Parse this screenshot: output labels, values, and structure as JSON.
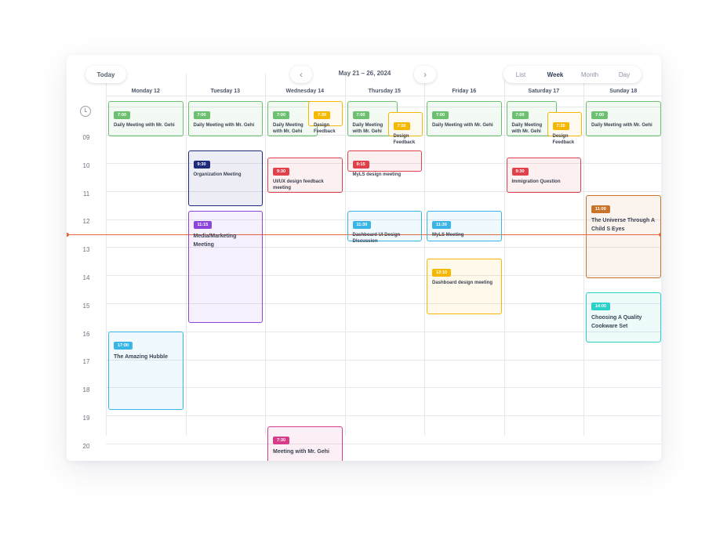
{
  "toolbar": {
    "today_label": "Today",
    "prev_glyph": "‹",
    "next_glyph": "›",
    "range_label": "May 21 – 26, 2024",
    "views": [
      "List",
      "Week",
      "Month",
      "Day"
    ],
    "active_view": "Week"
  },
  "days": [
    "Monday 12",
    "Tuesday 13",
    "Wednesday 14",
    "Thursday 15",
    "Friday 16",
    "Saturday 17",
    "Sunday 18"
  ],
  "hours": [
    "09",
    "10",
    "11",
    "12",
    "13",
    "14",
    "15",
    "16",
    "17",
    "18",
    "19",
    "20"
  ],
  "icons": {
    "allday": "clock-icon"
  },
  "colors": {
    "green": "#6cc070",
    "yellow": "#f5b800",
    "navy": "#1f2a7a",
    "red": "#e0414b",
    "purple": "#8c45d9",
    "cyan": "#3bb5e6",
    "orange": "#c9742a",
    "teal": "#2ad1c9",
    "pink": "#d63c8a",
    "now": "#e8643c"
  },
  "events": [
    {
      "day": 0,
      "start": 8,
      "end": 9.25,
      "time": "7:00",
      "title": "Daily Meeting with Mr. Gehi",
      "color": "green"
    },
    {
      "day": 1,
      "start": 8,
      "end": 9.25,
      "time": "7:00",
      "title": "Daily Meeting with Mr. Gehi",
      "color": "green"
    },
    {
      "day": 2,
      "start": 8,
      "end": 9.25,
      "time": "7:00",
      "title": "Daily Meeting with Mr. Gehi",
      "color": "green",
      "half": "left"
    },
    {
      "day": 2,
      "start": 8,
      "end": 8.9,
      "time": "7:30",
      "title": "Design Feedback",
      "color": "yellow",
      "half": "right"
    },
    {
      "day": 3,
      "start": 8,
      "end": 9.25,
      "time": "7:00",
      "title": "Daily Meeting with Mr. Gehi",
      "color": "green",
      "half": "left"
    },
    {
      "day": 3,
      "start": 8.4,
      "end": 9.25,
      "time": "7:30",
      "title": "Design Feedback",
      "color": "yellow",
      "half": "right"
    },
    {
      "day": 4,
      "start": 8,
      "end": 9.25,
      "time": "7:00",
      "title": "Daily Meeting with Mr. Gehi",
      "color": "green"
    },
    {
      "day": 5,
      "start": 8,
      "end": 9.25,
      "time": "7:00",
      "title": "Daily Meeting with Mr. Gehi",
      "color": "green",
      "half": "left"
    },
    {
      "day": 5,
      "start": 8.4,
      "end": 9.25,
      "time": "7:30",
      "title": "Design Feedback",
      "color": "yellow",
      "half": "right"
    },
    {
      "day": 6,
      "start": 8,
      "end": 9.25,
      "time": "7:00",
      "title": "Daily Meeting with Mr. Gehi",
      "color": "green"
    },
    {
      "day": 1,
      "start": 9.75,
      "end": 11.75,
      "time": "9:30",
      "title": "Organization Meeting",
      "color": "navy"
    },
    {
      "day": 2,
      "start": 10,
      "end": 11.25,
      "time": "9:30",
      "title": "UI/UX design feedback meeting",
      "color": "red"
    },
    {
      "day": 3,
      "start": 9.75,
      "end": 10.5,
      "time": "9:15",
      "title": "MyLS design meeting",
      "color": "red"
    },
    {
      "day": 5,
      "start": 10,
      "end": 11.25,
      "time": "9:30",
      "title": "Immigration Question",
      "color": "red"
    },
    {
      "day": 1,
      "start": 11.9,
      "end": 15.9,
      "time": "11:15",
      "title": "Media/Marketing Meeting",
      "color": "purple",
      "large": true
    },
    {
      "day": 3,
      "start": 11.9,
      "end": 13,
      "time": "11:30",
      "title": "Dashboard UI Design Discussion",
      "color": "cyan"
    },
    {
      "day": 4,
      "start": 11.9,
      "end": 13,
      "time": "11:30",
      "title": "MyLS Meeting",
      "color": "cyan"
    },
    {
      "day": 6,
      "start": 11.35,
      "end": 14.3,
      "time": "11:00",
      "title": "The Universe Through A Child S Eyes",
      "color": "orange",
      "large": true
    },
    {
      "day": 4,
      "start": 13.6,
      "end": 15.6,
      "time": "13:10",
      "title": "Dashboard design meeting",
      "color": "yellow"
    },
    {
      "day": 6,
      "start": 14.8,
      "end": 16.6,
      "time": "14:00",
      "title": "Choosing A Quality Cookware Set",
      "color": "teal",
      "large": true
    },
    {
      "day": 0,
      "start": 16.2,
      "end": 19,
      "time": "17:00",
      "title": "The Amazing Hubble",
      "color": "cyan",
      "large": true
    },
    {
      "day": 2,
      "start": 19.6,
      "end": 21,
      "time": "7:30",
      "title": "Meeting with Mr. Gehi",
      "color": "pink",
      "large": true
    }
  ],
  "now": 12.75
}
